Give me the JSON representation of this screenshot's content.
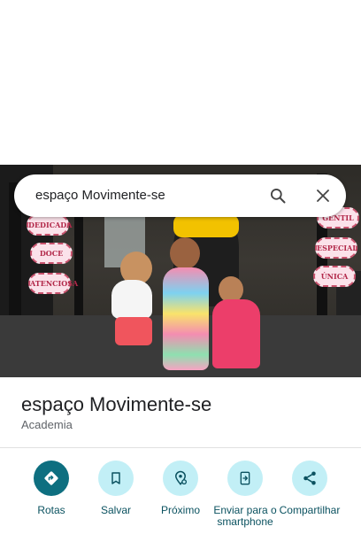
{
  "search": {
    "query": "espaço Movimente-se",
    "icons": {
      "search": "search-icon",
      "close": "close-icon"
    }
  },
  "photo": {
    "badges_left": [
      "DEDICADA",
      "DOCE",
      "ATENCIOSA"
    ],
    "badges_right": [
      "GENTIL",
      "ESPECIAL",
      "ÚNICA"
    ]
  },
  "place": {
    "name": "espaço Movimente-se",
    "category": "Academia"
  },
  "actions": [
    {
      "label": "Rotas",
      "icon": "directions-icon"
    },
    {
      "label": "Salvar",
      "icon": "bookmark-icon"
    },
    {
      "label": "Próximo",
      "icon": "nearby-icon"
    },
    {
      "label": "Enviar para o smartphone",
      "icon": "send-to-phone-icon"
    },
    {
      "label": "Compartilhar",
      "icon": "share-icon"
    }
  ],
  "colors": {
    "accent": "#0e6f80",
    "action_bg": "#c2eff6",
    "label_text": "#0b5260"
  }
}
